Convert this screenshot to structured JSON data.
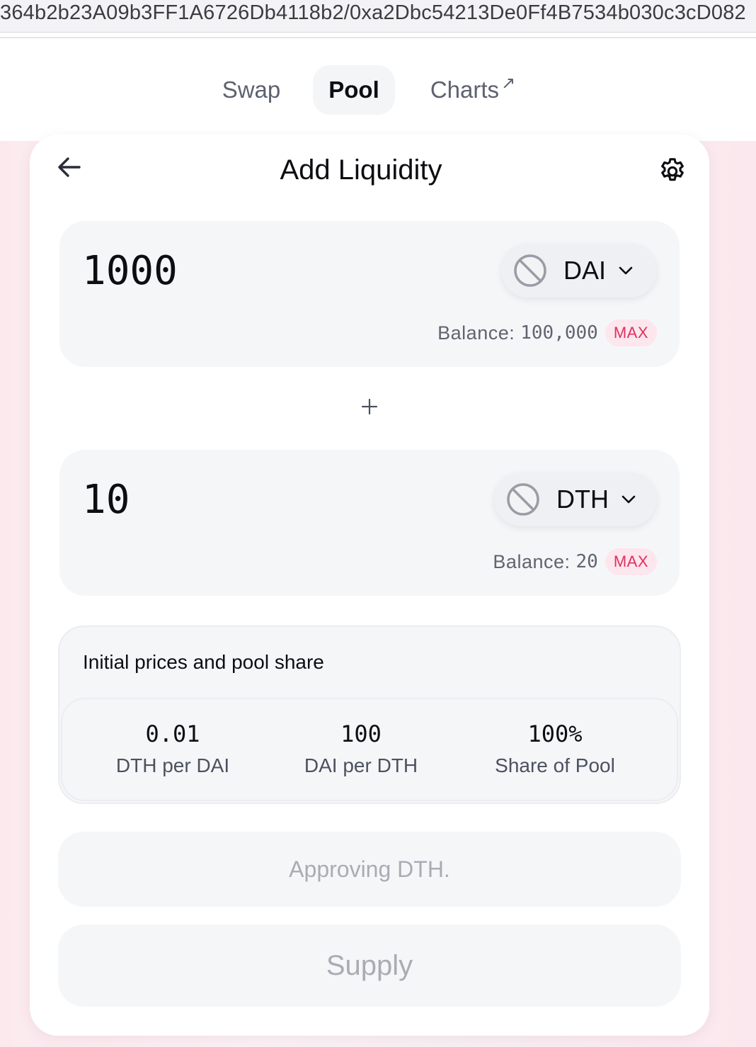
{
  "browser": {
    "url": "364b2b23A09b3FF1A6726Db4118b2/0xa2Dbc54213De0Ff4B7534b030c3cD082"
  },
  "nav": {
    "tabs": [
      {
        "label": "Swap"
      },
      {
        "label": "Pool",
        "active": true
      },
      {
        "label": "Charts",
        "arrow": "↗"
      }
    ]
  },
  "card": {
    "title": "Add Liquidity",
    "icons": {
      "back": "arrow-left-icon",
      "settings": "gear-icon"
    }
  },
  "inputs": [
    {
      "amount": "1000",
      "token": "DAI",
      "balance_label": "Balance:",
      "balance_value": "100,000",
      "max_label": "MAX"
    },
    {
      "amount": "10",
      "token": "DTH",
      "balance_label": "Balance:",
      "balance_value": "20",
      "max_label": "MAX"
    }
  ],
  "prices": {
    "title": "Initial prices and pool share",
    "stats": [
      {
        "value": "0.01",
        "label": "DTH per DAI"
      },
      {
        "value": "100",
        "label": "DAI per DTH"
      },
      {
        "value": "100%",
        "label": "Share of Pool"
      }
    ]
  },
  "buttons": {
    "approve_label": "Approving DTH.",
    "supply_label": "Supply"
  },
  "colors": {
    "accent_pink": "#e0305f",
    "max_bg": "#fde6ee",
    "panel_bg": "#f5f6f8",
    "disabled_text": "#a9acb4"
  }
}
